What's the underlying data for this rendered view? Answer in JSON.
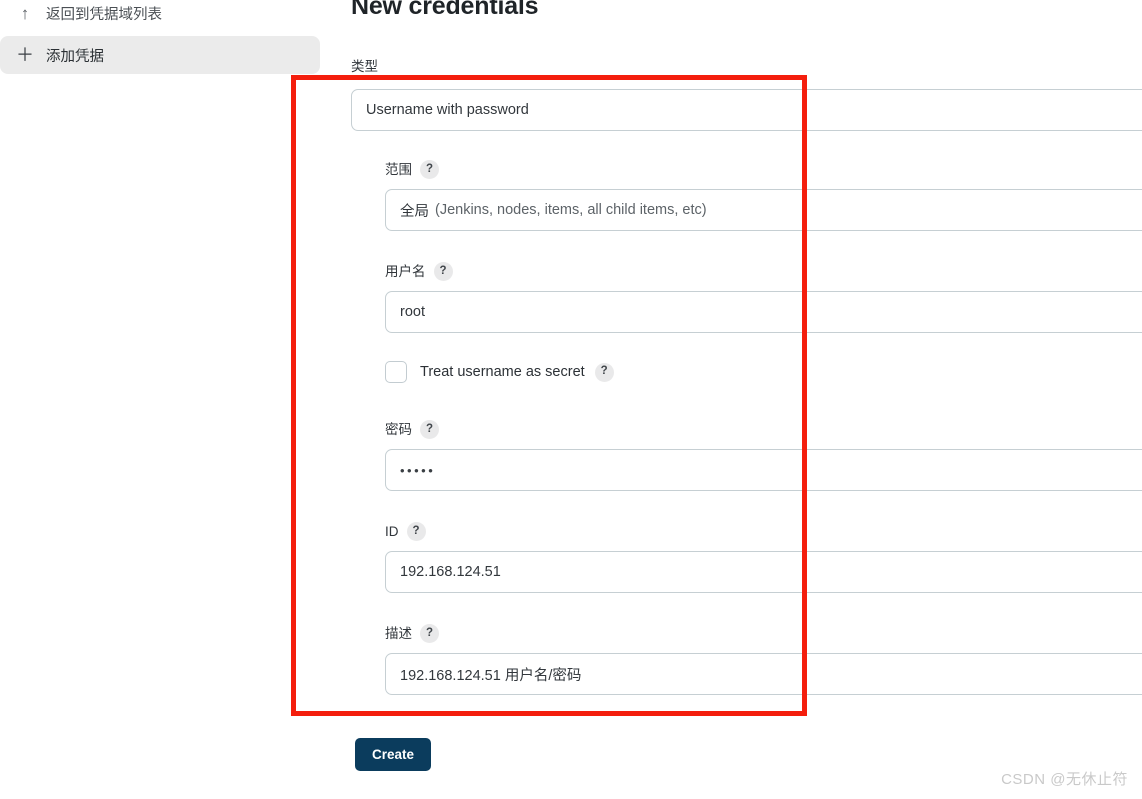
{
  "sidebar": {
    "items": [
      {
        "icon": "arrow-up-icon",
        "glyph": "↑",
        "label": "返回到凭据域列表"
      },
      {
        "icon": "plus-icon",
        "glyph": "＋",
        "label": "添加凭据"
      }
    ]
  },
  "main": {
    "title": "New credentials",
    "type_field": {
      "label": "类型",
      "value": "Username with password"
    },
    "scope_field": {
      "label": "范围",
      "help": "?",
      "value_primary": "全局",
      "value_secondary": "(Jenkins, nodes, items, all child items, etc)"
    },
    "username_field": {
      "label": "用户名",
      "help": "?",
      "value": "root"
    },
    "secret_checkbox": {
      "label": "Treat username as secret",
      "help": "?",
      "checked": false
    },
    "password_field": {
      "label": "密码",
      "help": "?",
      "value_masked": "•••••"
    },
    "id_field": {
      "label": "ID",
      "help": "?",
      "value": "192.168.124.51"
    },
    "description_field": {
      "label": "描述",
      "help": "?",
      "value": "192.168.124.51 用户名/密码"
    },
    "create_button": {
      "label": "Create"
    }
  },
  "annotation": {
    "color": "#f41e0d"
  },
  "watermark": {
    "text": "CSDN @无休止符"
  }
}
